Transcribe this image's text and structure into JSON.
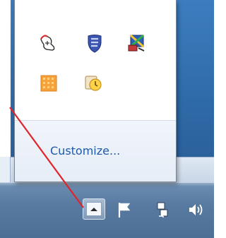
{
  "flyout": {
    "customize_label": "Customize...",
    "hidden_icons": [
      {
        "name": "mouse-icon"
      },
      {
        "name": "security-shield-icon"
      },
      {
        "name": "network-tool-icon"
      },
      {
        "name": "office-grid-icon"
      },
      {
        "name": "outlook-reminder-icon"
      }
    ]
  },
  "taskbar": {
    "show_hidden_icons": "chevron-up-icon",
    "tray_icons": [
      {
        "name": "action-center-flag-icon"
      },
      {
        "name": "network-icon"
      },
      {
        "name": "volume-icon"
      }
    ]
  },
  "colors": {
    "link": "#1e5aa8",
    "annotation_arrow": "#e0242a"
  }
}
